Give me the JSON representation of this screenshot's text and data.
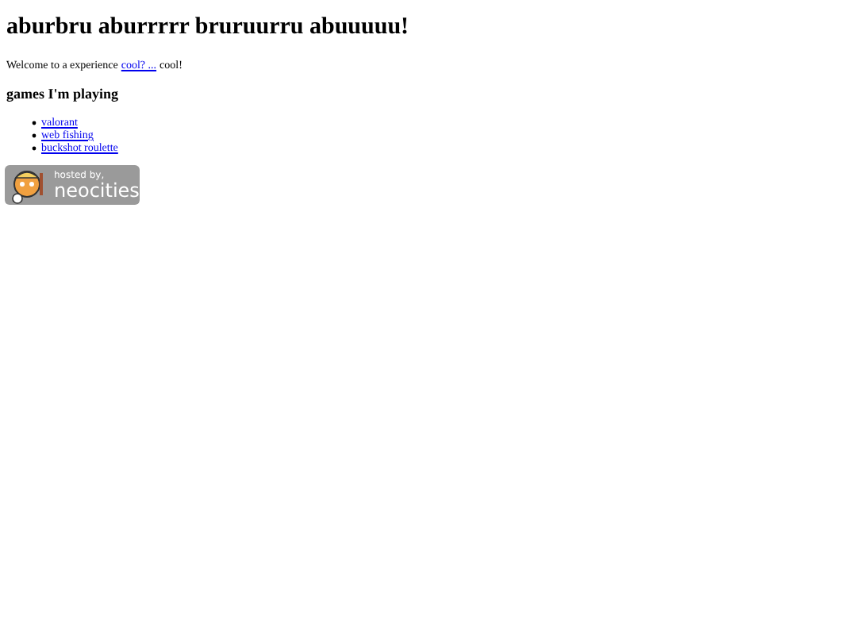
{
  "heading": "aburbru aburrrrr bruruurru abuuuuu!",
  "intro": {
    "before": "Welcome to a experience",
    "link": "cool? ...",
    "after": "cool!"
  },
  "games": {
    "title": "games I'm playing",
    "items": [
      {
        "label": "valorant"
      },
      {
        "label": "web fishing"
      },
      {
        "label": "buckshot roulette"
      }
    ]
  },
  "badge": {
    "line1": "hosted by,",
    "line2": "neocities"
  }
}
